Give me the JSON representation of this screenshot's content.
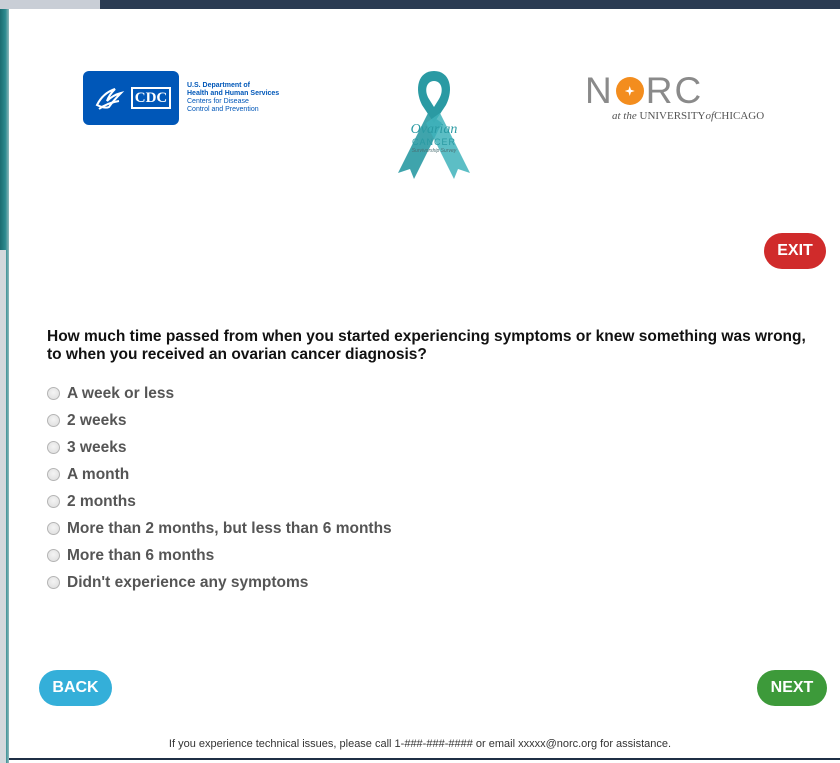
{
  "logos": {
    "cdc": {
      "badge_text": "CDC",
      "line1": "U.S. Department of",
      "line2": "Health and Human Services",
      "line3": "Centers for Disease",
      "line4": "Control and Prevention"
    },
    "ovarian": {
      "line1": "Ovarian",
      "line2": "CANCER",
      "line3": "Survivorship Survey",
      "ribbon_color": "#2a9aa3"
    },
    "norc": {
      "word_n": "N",
      "word_rc": "RC",
      "sub_prefix": "at the",
      "sub_university": "UNIVERSITY",
      "sub_of": "of",
      "sub_chicago": "CHICAGO",
      "accent_color": "#f38d1e"
    }
  },
  "buttons": {
    "exit": "EXIT",
    "back": "BACK",
    "next": "NEXT"
  },
  "colors": {
    "exit": "#d02b2b",
    "back": "#34afd9",
    "next": "#3d9a3a"
  },
  "question": {
    "text": "How much time passed from when you started experiencing symptoms or knew something was wrong, to when you received an ovarian cancer diagnosis?",
    "options": [
      "A week or less",
      "2 weeks",
      "3 weeks",
      "A month",
      "2 months",
      "More than 2 months, but less than 6 months",
      "More than 6 months",
      "Didn't experience any symptoms"
    ],
    "selected": null
  },
  "footer": {
    "text": "If you experience technical issues, please call 1-###-###-#### or email xxxxx@norc.org for assistance."
  }
}
